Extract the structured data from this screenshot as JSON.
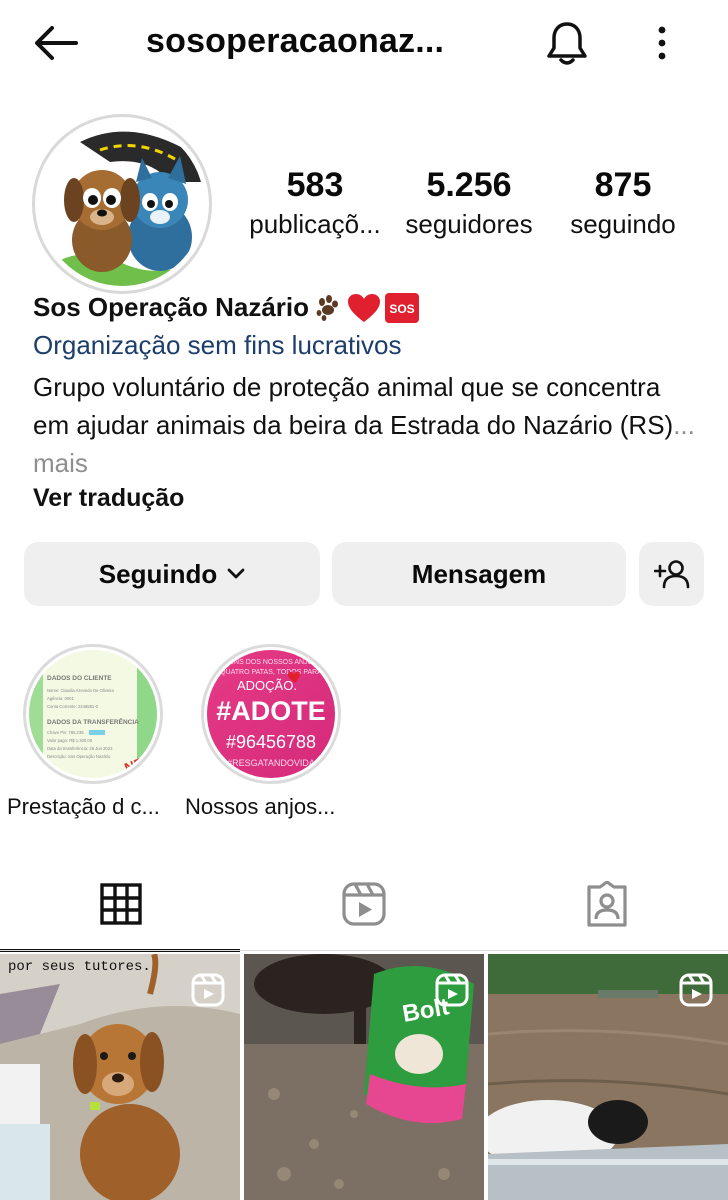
{
  "header": {
    "username": "sosoperacaonaz...",
    "icons": {
      "back": "arrow-left-icon",
      "bell": "bell-icon",
      "more": "more-vertical-icon"
    }
  },
  "profile": {
    "stats": [
      {
        "value": "583",
        "label": "publicaçõ..."
      },
      {
        "value": "5.256",
        "label": "seguidores"
      },
      {
        "value": "875",
        "label": "seguindo"
      }
    ],
    "name": "Sos Operação Nazário",
    "name_sos_badge": "SOS",
    "category": "Organização sem fins lucrativos",
    "bio": "Grupo voluntário de proteção animal que se concentra em ajudar animais da beira da Estrada do Nazário (RS)",
    "bio_more": "... mais",
    "translate": "Ver tradução"
  },
  "actions": {
    "following": "Seguindo",
    "message": "Mensagem"
  },
  "highlights": [
    {
      "label": "Prestação d c...",
      "card": {
        "title": "DADOS DO CLIENTE",
        "lines": [
          "Nome: Claudia Azevedo De Oliveira",
          "Agência: 0001",
          "Conta Corrente: 2246581-0"
        ],
        "title2": "DADOS DA TRANSFERÊNCIA",
        "lines2": [
          "Chave Pix: 785.236.",
          "Valor pago: R$ 1.300,00",
          "Data da transferência: 26 Jun 2023",
          "Descrição: Sos Operação Nazário"
        ],
        "stamp": "NEL"
      }
    },
    {
      "label": "Nossos anjos...",
      "card": {
        "line1": "UNS DOS NOSSOS ANJO",
        "line2": "QUATRO PATAS, TODOS PARA",
        "line3": "ADOÇÃO.",
        "hashtag": "#ADOTE",
        "phone": "#96456788",
        "footer": "#RESGATANDOVIDA"
      }
    }
  ],
  "tabs": [
    "grid-icon",
    "reels-icon",
    "tagged-icon"
  ],
  "posts": [
    {
      "caption": "por seus tutores."
    },
    {
      "caption": "Bolt"
    },
    {
      "caption": ""
    }
  ],
  "colors": {
    "link": "#1d3d6b",
    "button_bg": "#efefef",
    "muted": "#8e8e8e"
  }
}
